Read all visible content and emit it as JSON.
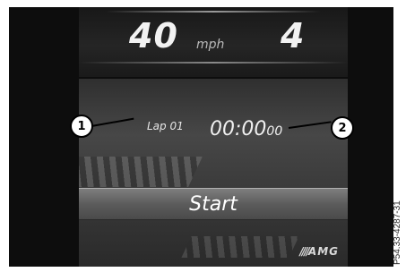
{
  "speed_bar": {
    "speed": "40",
    "unit": "mph",
    "gear": "4"
  },
  "lap": {
    "label": "Lap 01",
    "time_main": "00:00",
    "time_fraction": "00"
  },
  "start_button": {
    "label": "Start"
  },
  "branding": {
    "logo_text": "AMG"
  },
  "callouts": [
    "1",
    "2"
  ],
  "reference_code": "P54.33-4287-31",
  "colors": {
    "screen_bg": "#0d0d0d",
    "text": "#f2f2f2",
    "button": "#6a6a6a"
  }
}
